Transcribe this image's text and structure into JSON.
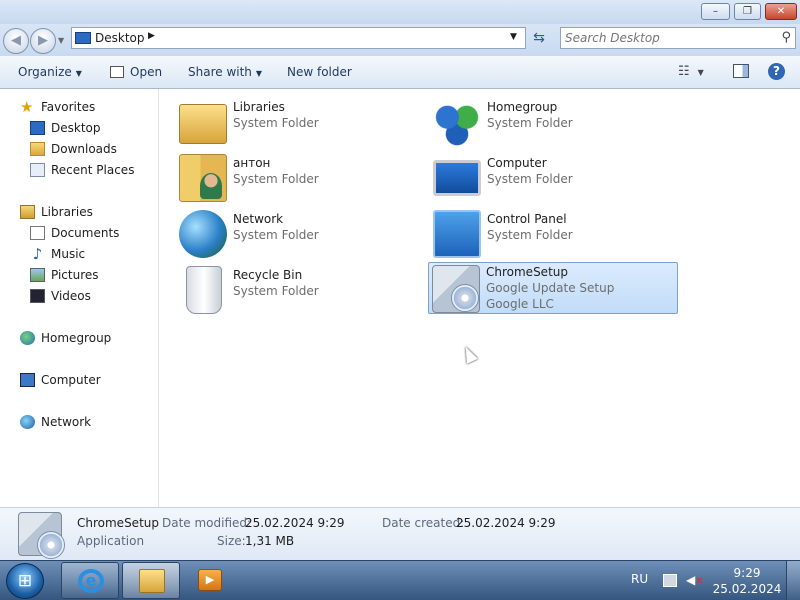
{
  "window": {
    "controls": {
      "minimize": "–",
      "maximize": "❐",
      "close": "✕"
    }
  },
  "address_bar": {
    "location": "Desktop",
    "search_placeholder": "Search Desktop"
  },
  "toolbar": {
    "organize": "Organize",
    "open": "Open",
    "share_with": "Share with",
    "new_folder": "New folder"
  },
  "nav_pane": {
    "favorites": {
      "label": "Favorites",
      "items": [
        "Desktop",
        "Downloads",
        "Recent Places"
      ]
    },
    "libraries": {
      "label": "Libraries",
      "items": [
        "Documents",
        "Music",
        "Pictures",
        "Videos"
      ]
    },
    "homegroup": "Homegroup",
    "computer": "Computer",
    "network": "Network"
  },
  "content": {
    "tiles": [
      {
        "name": "Libraries",
        "type": "System Folder",
        "icon": "libraries-icon"
      },
      {
        "name": "Homegroup",
        "type": "System Folder",
        "icon": "homegroup-icon"
      },
      {
        "name": "антон",
        "type": "System Folder",
        "icon": "user-folder-icon"
      },
      {
        "name": "Computer",
        "type": "System Folder",
        "icon": "computer-icon"
      },
      {
        "name": "Network",
        "type": "System Folder",
        "icon": "network-icon"
      },
      {
        "name": "Control Panel",
        "type": "System Folder",
        "icon": "control-panel-icon"
      },
      {
        "name": "Recycle Bin",
        "type": "System Folder",
        "icon": "recycle-bin-icon"
      },
      {
        "name": "ChromeSetup",
        "type": "Google Update Setup",
        "company": "Google LLC",
        "icon": "setup-icon",
        "selected": true
      }
    ]
  },
  "details_pane": {
    "name": "ChromeSetup",
    "kind": "Application",
    "date_modified_label": "Date modified:",
    "date_modified": "25.02.2024 9:29",
    "size_label": "Size:",
    "size": "1,31 MB",
    "date_created_label": "Date created:",
    "date_created": "25.02.2024 9:29"
  },
  "taskbar": {
    "language": "RU",
    "time": "9:29",
    "date": "25.02.2024"
  }
}
